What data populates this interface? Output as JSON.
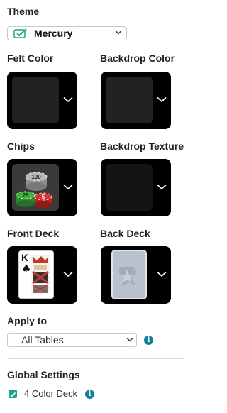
{
  "theme": {
    "label": "Theme",
    "selected": "Mercury",
    "icon": "theme-check-icon"
  },
  "sections": {
    "felt_color": "Felt Color",
    "backdrop_color": "Backdrop Color",
    "chips": "Chips",
    "backdrop_texture": "Backdrop Texture",
    "front_deck": "Front Deck",
    "back_deck": "Back Deck"
  },
  "chips_values": [
    "100",
    "25",
    "5"
  ],
  "front_card": {
    "rank": "K",
    "suit": "♠"
  },
  "apply_to": {
    "label": "Apply to",
    "selected": "All Tables"
  },
  "global_settings": {
    "label": "Global Settings",
    "four_color_deck": {
      "label": "4 Color Deck",
      "checked": true
    }
  },
  "colors": {
    "accent_teal": "#1fa38a",
    "info_blue": "#137fa0",
    "tile_bg": "#000000",
    "swatch_dark": "#222222"
  }
}
